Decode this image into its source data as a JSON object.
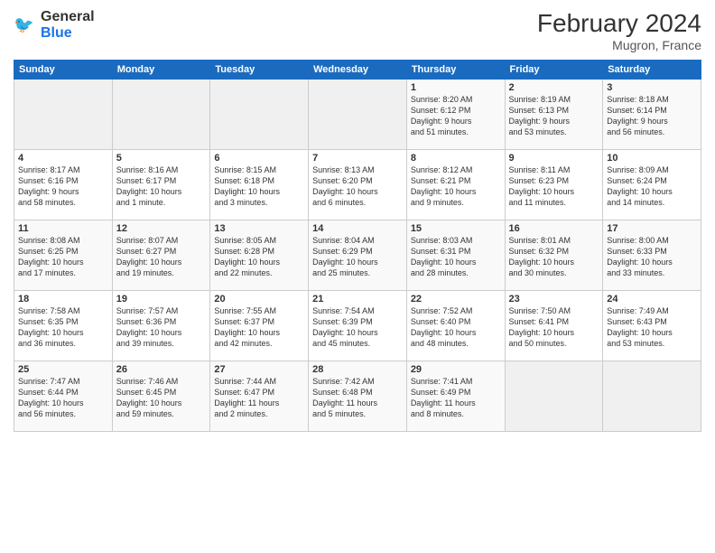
{
  "header": {
    "logo_general": "General",
    "logo_blue": "Blue",
    "month_year": "February 2024",
    "location": "Mugron, France"
  },
  "days_of_week": [
    "Sunday",
    "Monday",
    "Tuesday",
    "Wednesday",
    "Thursday",
    "Friday",
    "Saturday"
  ],
  "weeks": [
    [
      {
        "day": "",
        "info": ""
      },
      {
        "day": "",
        "info": ""
      },
      {
        "day": "",
        "info": ""
      },
      {
        "day": "",
        "info": ""
      },
      {
        "day": "1",
        "info": "Sunrise: 8:20 AM\nSunset: 6:12 PM\nDaylight: 9 hours\nand 51 minutes."
      },
      {
        "day": "2",
        "info": "Sunrise: 8:19 AM\nSunset: 6:13 PM\nDaylight: 9 hours\nand 53 minutes."
      },
      {
        "day": "3",
        "info": "Sunrise: 8:18 AM\nSunset: 6:14 PM\nDaylight: 9 hours\nand 56 minutes."
      }
    ],
    [
      {
        "day": "4",
        "info": "Sunrise: 8:17 AM\nSunset: 6:16 PM\nDaylight: 9 hours\nand 58 minutes."
      },
      {
        "day": "5",
        "info": "Sunrise: 8:16 AM\nSunset: 6:17 PM\nDaylight: 10 hours\nand 1 minute."
      },
      {
        "day": "6",
        "info": "Sunrise: 8:15 AM\nSunset: 6:18 PM\nDaylight: 10 hours\nand 3 minutes."
      },
      {
        "day": "7",
        "info": "Sunrise: 8:13 AM\nSunset: 6:20 PM\nDaylight: 10 hours\nand 6 minutes."
      },
      {
        "day": "8",
        "info": "Sunrise: 8:12 AM\nSunset: 6:21 PM\nDaylight: 10 hours\nand 9 minutes."
      },
      {
        "day": "9",
        "info": "Sunrise: 8:11 AM\nSunset: 6:23 PM\nDaylight: 10 hours\nand 11 minutes."
      },
      {
        "day": "10",
        "info": "Sunrise: 8:09 AM\nSunset: 6:24 PM\nDaylight: 10 hours\nand 14 minutes."
      }
    ],
    [
      {
        "day": "11",
        "info": "Sunrise: 8:08 AM\nSunset: 6:25 PM\nDaylight: 10 hours\nand 17 minutes."
      },
      {
        "day": "12",
        "info": "Sunrise: 8:07 AM\nSunset: 6:27 PM\nDaylight: 10 hours\nand 19 minutes."
      },
      {
        "day": "13",
        "info": "Sunrise: 8:05 AM\nSunset: 6:28 PM\nDaylight: 10 hours\nand 22 minutes."
      },
      {
        "day": "14",
        "info": "Sunrise: 8:04 AM\nSunset: 6:29 PM\nDaylight: 10 hours\nand 25 minutes."
      },
      {
        "day": "15",
        "info": "Sunrise: 8:03 AM\nSunset: 6:31 PM\nDaylight: 10 hours\nand 28 minutes."
      },
      {
        "day": "16",
        "info": "Sunrise: 8:01 AM\nSunset: 6:32 PM\nDaylight: 10 hours\nand 30 minutes."
      },
      {
        "day": "17",
        "info": "Sunrise: 8:00 AM\nSunset: 6:33 PM\nDaylight: 10 hours\nand 33 minutes."
      }
    ],
    [
      {
        "day": "18",
        "info": "Sunrise: 7:58 AM\nSunset: 6:35 PM\nDaylight: 10 hours\nand 36 minutes."
      },
      {
        "day": "19",
        "info": "Sunrise: 7:57 AM\nSunset: 6:36 PM\nDaylight: 10 hours\nand 39 minutes."
      },
      {
        "day": "20",
        "info": "Sunrise: 7:55 AM\nSunset: 6:37 PM\nDaylight: 10 hours\nand 42 minutes."
      },
      {
        "day": "21",
        "info": "Sunrise: 7:54 AM\nSunset: 6:39 PM\nDaylight: 10 hours\nand 45 minutes."
      },
      {
        "day": "22",
        "info": "Sunrise: 7:52 AM\nSunset: 6:40 PM\nDaylight: 10 hours\nand 48 minutes."
      },
      {
        "day": "23",
        "info": "Sunrise: 7:50 AM\nSunset: 6:41 PM\nDaylight: 10 hours\nand 50 minutes."
      },
      {
        "day": "24",
        "info": "Sunrise: 7:49 AM\nSunset: 6:43 PM\nDaylight: 10 hours\nand 53 minutes."
      }
    ],
    [
      {
        "day": "25",
        "info": "Sunrise: 7:47 AM\nSunset: 6:44 PM\nDaylight: 10 hours\nand 56 minutes."
      },
      {
        "day": "26",
        "info": "Sunrise: 7:46 AM\nSunset: 6:45 PM\nDaylight: 10 hours\nand 59 minutes."
      },
      {
        "day": "27",
        "info": "Sunrise: 7:44 AM\nSunset: 6:47 PM\nDaylight: 11 hours\nand 2 minutes."
      },
      {
        "day": "28",
        "info": "Sunrise: 7:42 AM\nSunset: 6:48 PM\nDaylight: 11 hours\nand 5 minutes."
      },
      {
        "day": "29",
        "info": "Sunrise: 7:41 AM\nSunset: 6:49 PM\nDaylight: 11 hours\nand 8 minutes."
      },
      {
        "day": "",
        "info": ""
      },
      {
        "day": "",
        "info": ""
      }
    ]
  ]
}
